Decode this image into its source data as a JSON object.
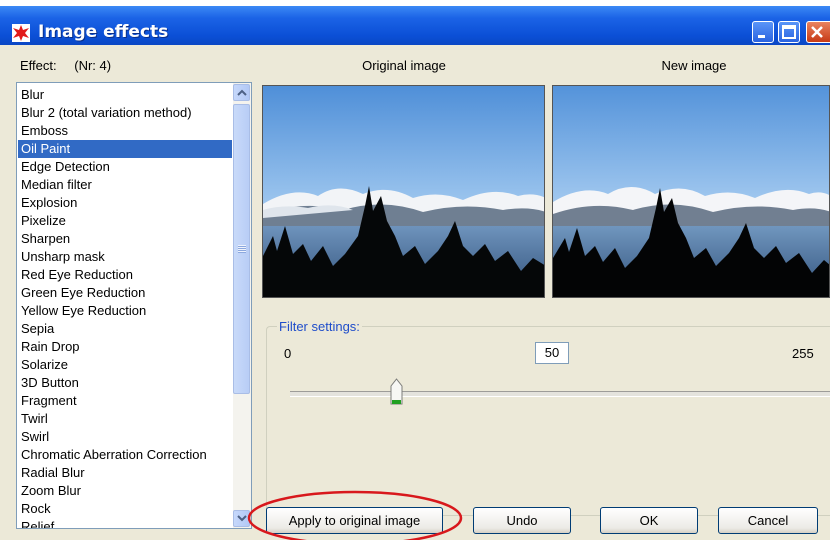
{
  "window": {
    "title": "Image effects"
  },
  "effects": {
    "header_label": "Effect:",
    "count_label": "(Nr: 4)",
    "items": [
      "Blur",
      "Blur 2 (total variation method)",
      "Emboss",
      "Oil Paint",
      "Edge Detection",
      "Median filter",
      "Explosion",
      "Pixelize",
      "Sharpen",
      "Unsharp mask",
      "Red Eye Reduction",
      "Green Eye Reduction",
      "Yellow Eye Reduction",
      "Sepia",
      "Rain Drop",
      "Solarize",
      "3D Button",
      "Fragment",
      "Twirl",
      "Swirl",
      "Chromatic Aberration Correction",
      "Radial Blur",
      "Zoom Blur",
      "Rock",
      "Relief"
    ],
    "selected": "Oil Paint"
  },
  "images": {
    "original_label": "Original image",
    "new_label": "New image"
  },
  "filter": {
    "group_label": "Filter settings:",
    "min_label": "0",
    "max_label": "255",
    "value": "50",
    "slider_fraction": 0.196
  },
  "buttons": {
    "apply": "Apply to original image",
    "undo": "Undo",
    "ok": "OK",
    "cancel": "Cancel"
  },
  "colors": {
    "selection": "#316ac5",
    "group_label": "#1f4dca",
    "highlight_ellipse": "#d8181c"
  },
  "icons": {
    "app": "red-splat-icon",
    "minimize": "minimize-icon",
    "maximize": "maximize-icon",
    "close": "close-icon"
  }
}
